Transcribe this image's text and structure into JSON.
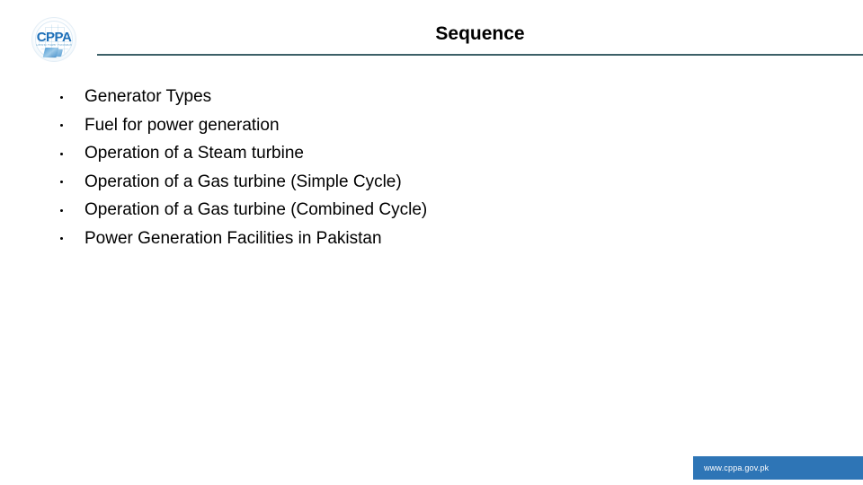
{
  "slide": {
    "title": "Sequence",
    "background_color": "#ffffff",
    "rule_color": "#3d6068"
  },
  "logo": {
    "name": "cppa-logo",
    "text": "CPPA",
    "subtext": "Central Power Purchasing Agency",
    "color": "#1d6fb8"
  },
  "bullets": [
    {
      "text": "Generator Types"
    },
    {
      "text": "Fuel for power generation"
    },
    {
      "text": "Operation of a Steam turbine"
    },
    {
      "text": "Operation of a Gas turbine (Simple Cycle)"
    },
    {
      "text": "Operation of a Gas turbine (Combined Cycle)"
    },
    {
      "text": "Power Generation Facilities in Pakistan"
    }
  ],
  "footer": {
    "website": "www.cppa.gov.pk",
    "bar_color": "#2e75b6",
    "text_color": "#ffffff"
  }
}
